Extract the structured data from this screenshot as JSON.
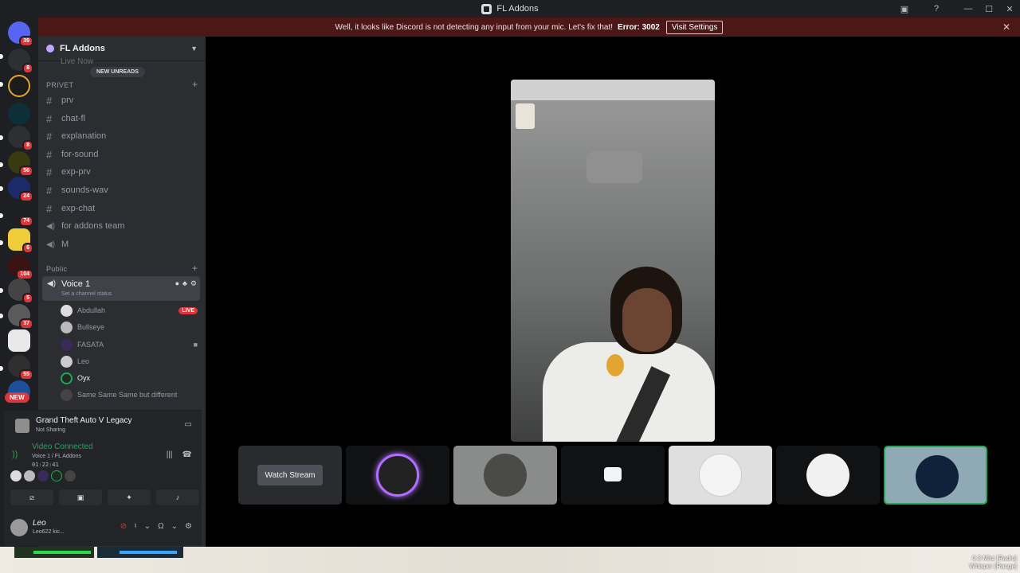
{
  "window": {
    "title": "FL Addons"
  },
  "notice": {
    "text": "Well, it looks like Discord is not detecting any input from your mic. Let's fix that!",
    "error": "Error: 3002",
    "button": "Visit Settings"
  },
  "rail": {
    "badges": [
      "39",
      "8",
      "8",
      "56",
      "24",
      "74",
      "6",
      "104",
      "5",
      "37",
      "55"
    ],
    "new_label": "NEW"
  },
  "server": {
    "name": "FL Addons",
    "live_now": "Live Now",
    "new_unreads": "NEW UNREADS",
    "categories": [
      {
        "name": "PRIVET",
        "channels": [
          {
            "type": "text",
            "name": "prv"
          },
          {
            "type": "text",
            "name": "chat-fl"
          },
          {
            "type": "text",
            "name": "explanation"
          },
          {
            "type": "text",
            "name": "for-sound"
          },
          {
            "type": "text",
            "name": "exp-prv"
          },
          {
            "type": "text",
            "name": "sounds-wav"
          },
          {
            "type": "text",
            "name": "exp-chat"
          },
          {
            "type": "voice",
            "name": "for addons team"
          },
          {
            "type": "voice",
            "name": "M"
          }
        ]
      },
      {
        "name": "Public"
      }
    ],
    "voice_channel": {
      "name": "Voice 1",
      "status_placeholder": "Set a channel status",
      "users": [
        {
          "name": "Abdullah",
          "badge": "LIVE"
        },
        {
          "name": "Bullseye"
        },
        {
          "name": "FASATA",
          "camera": true
        },
        {
          "name": "Leo"
        },
        {
          "name": "Oyx"
        },
        {
          "name": "Same Same Same but different"
        }
      ]
    }
  },
  "activity": {
    "game": "Grand Theft Auto V Legacy",
    "status": "Not Sharing"
  },
  "voice_panel": {
    "status": "Video Connected",
    "location": "Voice 1 / FL Addons",
    "elapsed": "01:22:41"
  },
  "user_panel": {
    "name": "Leo",
    "status": "Leo622 kic..."
  },
  "stage": {
    "watch_stream": "Watch Stream"
  },
  "overlay": {
    "radio_line1": "0.3 Mhz [Radio]",
    "radio_line2": "Whisper [Range]"
  },
  "colors": {
    "accent_green": "#23a55a",
    "danger": "#da373c",
    "live_ring": "#b06dff"
  }
}
